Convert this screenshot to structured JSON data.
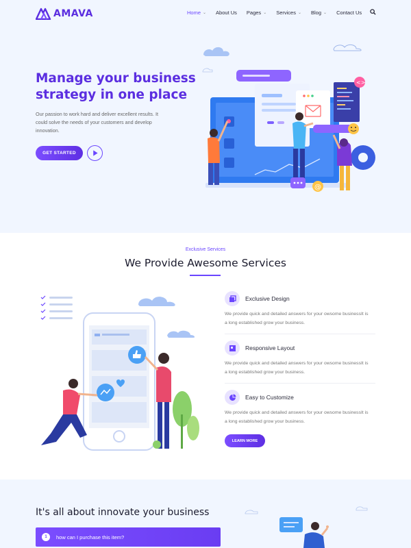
{
  "brand": {
    "name": "AMAVA",
    "color": "#5b2ee0"
  },
  "nav": {
    "items": [
      {
        "label": "Home",
        "has_dropdown": true,
        "active": true
      },
      {
        "label": "About Us",
        "has_dropdown": false,
        "active": false
      },
      {
        "label": "Pages",
        "has_dropdown": true,
        "active": false
      },
      {
        "label": "Services",
        "has_dropdown": true,
        "active": false
      },
      {
        "label": "Blog",
        "has_dropdown": true,
        "active": false
      },
      {
        "label": "Contact Us",
        "has_dropdown": false,
        "active": false
      }
    ],
    "search_icon": "search-icon"
  },
  "hero": {
    "title": "Manage your business strategy in one place",
    "description": "Our passion to work hard and deliver excellent results. It could solve the needs of your customers and develop innovation.",
    "cta_label": "GET STARTED",
    "play_icon": "play-icon"
  },
  "services": {
    "tag": "Exclusive Services",
    "title": "We Provide Awesome Services",
    "items": [
      {
        "icon": "design-icon",
        "name": "Exclusive Design",
        "text": "We provide quick and detailed answers for your owsome businessIt is a long established grow your business."
      },
      {
        "icon": "layout-icon",
        "name": "Responsive Layout",
        "text": "We provide quick and detailed answers for your owsome businessIt is a long established grow your business."
      },
      {
        "icon": "pie-chart-icon",
        "name": "Easy to Customize",
        "text": "We provide quick and detailed answers for your owsome businessIt is a long established grow your business."
      }
    ],
    "more_label": "LEARN MORE"
  },
  "innovate": {
    "title": "It's all about innovate your business",
    "faq": {
      "num": "1",
      "question": "how can I purchase this item?"
    }
  },
  "colors": {
    "accent": "#6a45ff",
    "hero_bg": "#f1f6ff"
  }
}
